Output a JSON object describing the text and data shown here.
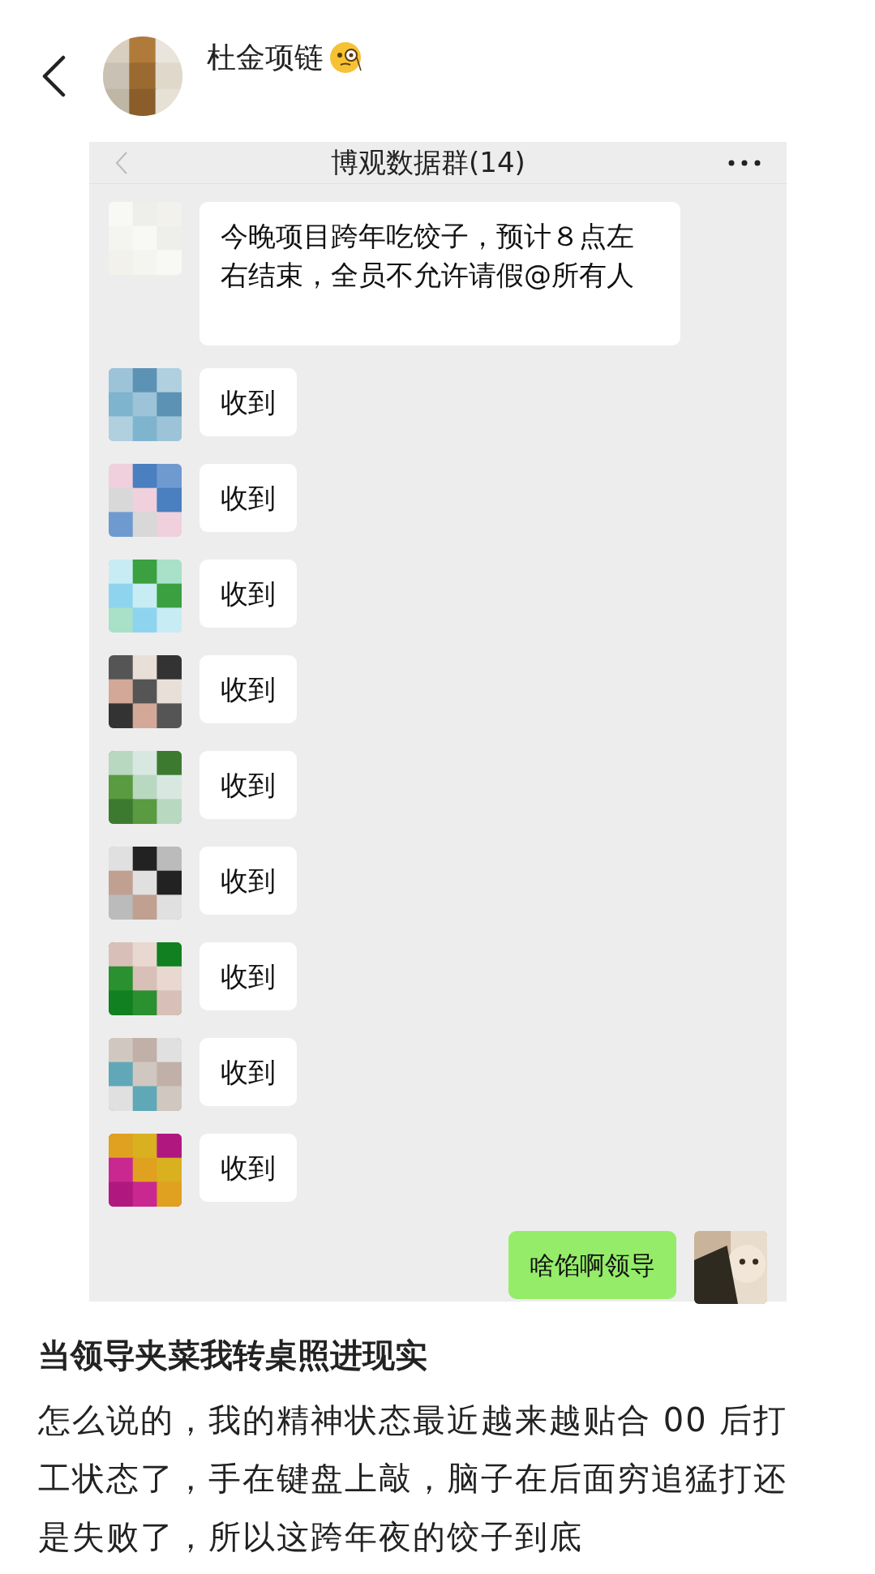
{
  "author": {
    "name": "杜金项链"
  },
  "chat_screenshot": {
    "title": "博观数据群(14)",
    "messages": [
      {
        "kind": "received",
        "text": "今晚项目跨年吃饺子，预计８点左右结束，全员不允许请假@所有人"
      },
      {
        "kind": "received",
        "text": "收到"
      },
      {
        "kind": "received",
        "text": "收到"
      },
      {
        "kind": "received",
        "text": "收到"
      },
      {
        "kind": "received",
        "text": "收到"
      },
      {
        "kind": "received",
        "text": "收到"
      },
      {
        "kind": "received",
        "text": "收到"
      },
      {
        "kind": "received",
        "text": "收到"
      },
      {
        "kind": "received",
        "text": "收到"
      },
      {
        "kind": "received",
        "text": "收到"
      },
      {
        "kind": "sent",
        "text": "啥馅啊领导"
      }
    ]
  },
  "headline": "当领导夹菜我转桌照进现实",
  "body_lines": [
    "怎么说的，我的精神状态最近越来越贴合 00 后打",
    "工状态了，手在键盘上敲，脑子在后面穷追猛打还",
    "是失败了，所以这跨年夜的饺子到底"
  ]
}
